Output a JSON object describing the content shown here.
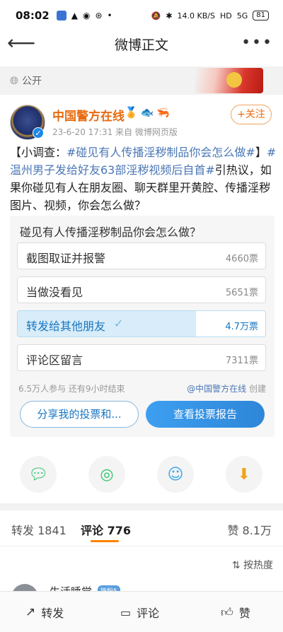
{
  "status_bar": {
    "time": "08:02",
    "network_speed": "14.0 KB/S",
    "hd": "HD",
    "signal": "5G",
    "battery": "81"
  },
  "nav": {
    "title": "微博正文",
    "more": "•••"
  },
  "visibility": {
    "label": "公开"
  },
  "author": {
    "name": "中国警方在线",
    "meta": "23-6-20 17:31  来自 微博网页版",
    "follow_label": "+关注"
  },
  "post": {
    "prefix": "【小调查：",
    "topic1": "#碰见有人传播淫秽制品你会怎么做#",
    "mid": "】",
    "topic2": "#温州男子发给好友63部淫秽视频后自首#",
    "rest": "引热议，如果你碰见有人在朋友圈、聊天群里开黄腔、传播淫秽图片、视频，你会怎么做？"
  },
  "poll": {
    "question": "碰见有人传播淫秽制品你会怎么做？",
    "options": [
      {
        "label": "截图取证并报警",
        "count": "4660票",
        "fraction": 0.0,
        "selected": false
      },
      {
        "label": "当做没看见",
        "count": "5651票",
        "fraction": 0.0,
        "selected": false
      },
      {
        "label": "转发给其他朋友",
        "count": "4.7万票",
        "fraction": 0.72,
        "selected": true
      },
      {
        "label": "评论区留言",
        "count": "7311票",
        "fraction": 0.0,
        "selected": false
      }
    ],
    "participants": "6.5万人参与  还有9小时结束",
    "creator_at": "@中国警方在线",
    "creator_suffix": " 创建",
    "share_button": "分享我的投票和...",
    "report_button": "查看投票报告"
  },
  "share_icons": [
    "wechat-icon",
    "moments-icon",
    "qq-icon",
    "save-image-icon"
  ],
  "tabs": {
    "repost": "转发 1841",
    "comment": "评论 776",
    "like": "赞 8.1万"
  },
  "sort": {
    "label": "按热度"
  },
  "comment": {
    "name": "生活睡觉",
    "badge": "铁粉5"
  },
  "bottom_bar": {
    "repost": "转发",
    "comment": "评论",
    "like": "赞"
  },
  "colors": {
    "accent": "#ff8200",
    "link": "#4a77b5",
    "author": "#e86b10",
    "poll_selected": "#1a76c1"
  }
}
